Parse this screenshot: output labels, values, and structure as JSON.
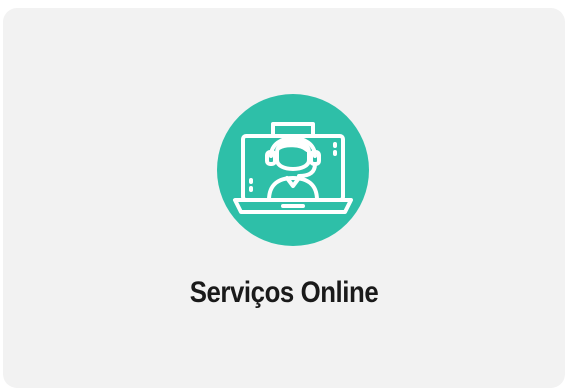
{
  "card": {
    "title": "Serviços Online",
    "icon": "online-support-agent-icon",
    "icon_bg_color": "#2ebfa8",
    "icon_line_color": "#ffffff",
    "card_bg_color": "#f2f2f2"
  }
}
